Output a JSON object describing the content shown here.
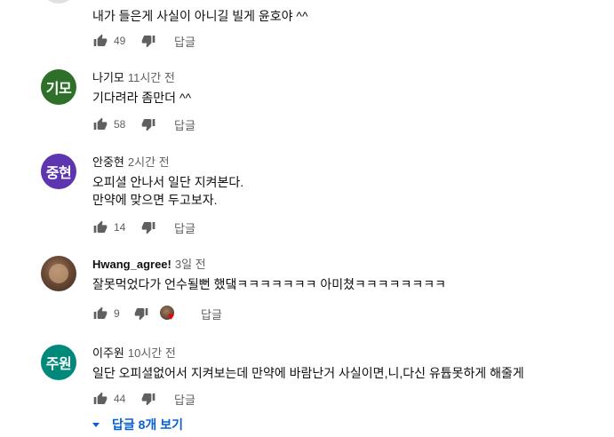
{
  "comments": [
    {
      "text": "내가 들은게 사실이 아니길 빌게 윤호야 ^^",
      "likes": "49",
      "reply_label": "답글"
    },
    {
      "avatar_text": "기모",
      "avatar_color": "#2e6f2a",
      "author": "나기모",
      "time": "11시간 전",
      "text": "기다려라 좀만더 ^^",
      "likes": "58",
      "reply_label": "답글"
    },
    {
      "avatar_text": "중현",
      "avatar_color": "#5e35b1",
      "author": "안중현",
      "time": "2시간 전",
      "text": "오피셜 안나서 일단 지켜본다.\n만약에 맞으면 두고보자.",
      "likes": "14",
      "reply_label": "답글"
    },
    {
      "author": "Hwang_agree!",
      "time": "3일 전",
      "text": "잘못먹었다가 언수될뻔 했댘ㅋㅋㅋㅋㅋㅋㅋ 아미쳤ㅋㅋㅋㅋㅋㅋㅋㅋ",
      "likes": "9",
      "reply_label": "답글"
    },
    {
      "avatar_text": "주원",
      "avatar_color": "#00897b",
      "author": "이주원",
      "time": "10시간 전",
      "text": "일단 오피셜없어서 지켜보는데 만약에 바람난거 사실이면,니,다신 유튭못하게 해줄게",
      "likes": "44",
      "reply_label": "답글"
    }
  ],
  "view_replies": "답글 8개 보기"
}
